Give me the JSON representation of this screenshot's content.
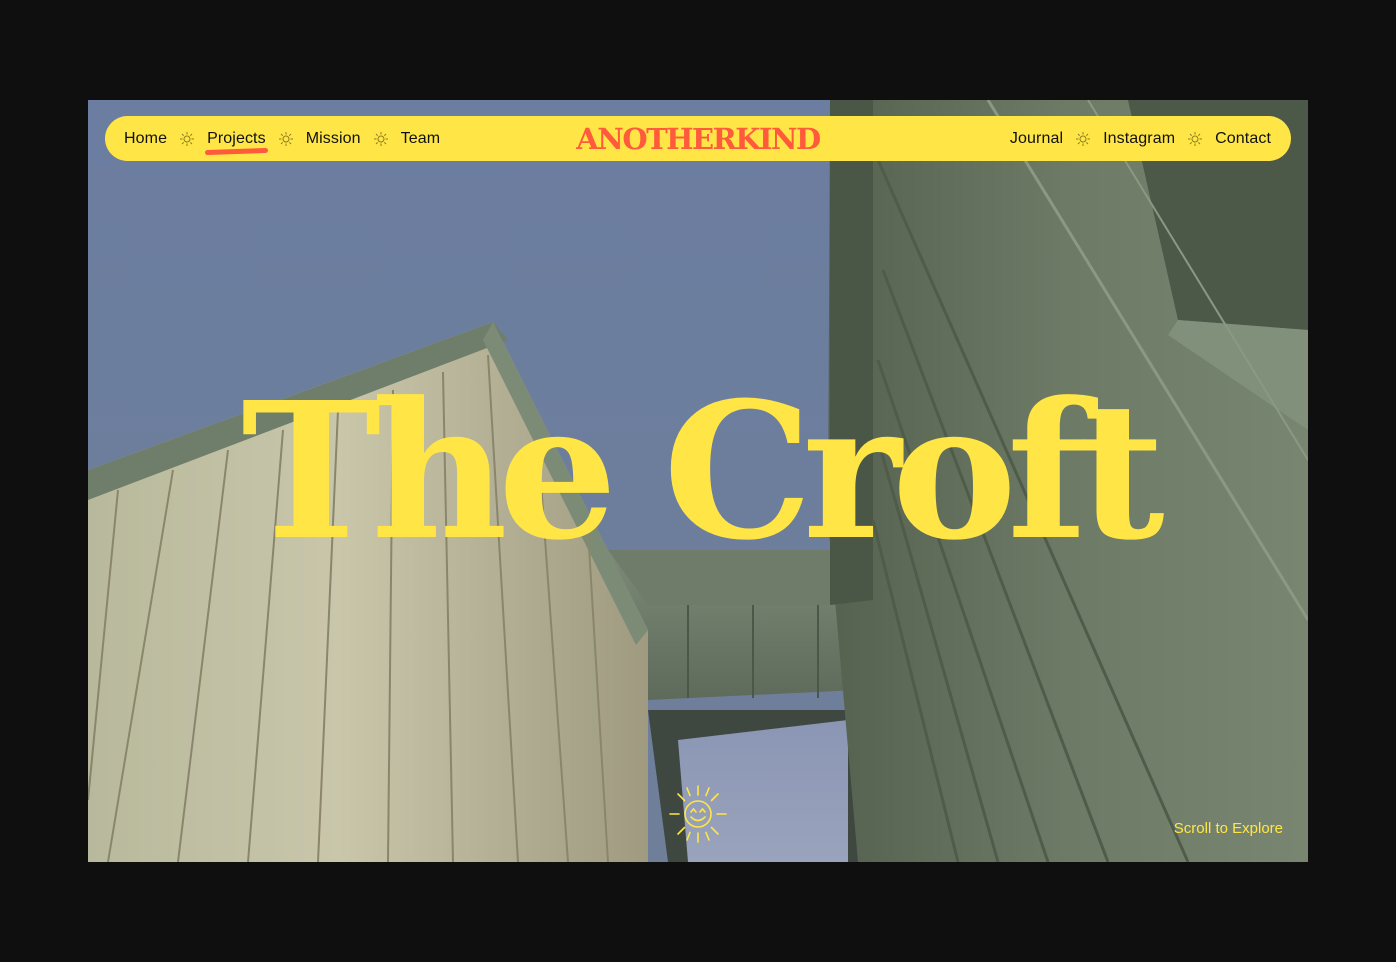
{
  "nav": {
    "left": [
      {
        "label": "Home"
      },
      {
        "label": "Projects",
        "active": true
      },
      {
        "label": "Mission"
      },
      {
        "label": "Team"
      }
    ],
    "brand": "ANOTHERKIND",
    "right": [
      {
        "label": "Journal"
      },
      {
        "label": "Instagram"
      },
      {
        "label": "Contact"
      }
    ],
    "separator_icon": "sun-icon"
  },
  "hero": {
    "title": "The Croft",
    "scroll_cta": "Scroll to Explore",
    "mascot_icon": "smiling-sun-icon"
  },
  "colors": {
    "background": "#0f0f0f",
    "accent_yellow": "#ffe646",
    "accent_red": "#ff5a3c",
    "text_dark": "#111111"
  }
}
